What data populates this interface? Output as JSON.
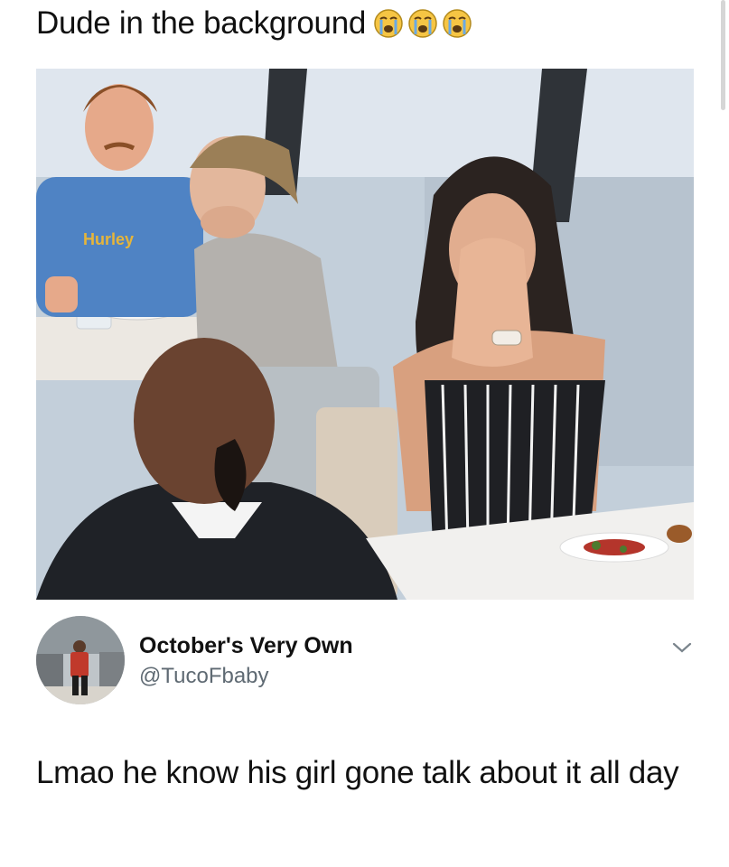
{
  "meme": {
    "caption": "Dude in the background",
    "caption_emoji": [
      "loudly-crying-face-icon",
      "loudly-crying-face-icon",
      "loudly-crying-face-icon"
    ],
    "shirt_logo": "Hurley"
  },
  "tweet": {
    "display_name": "October's Very Own",
    "handle": "@TucoFbaby",
    "text": "Lmao he know his girl gone talk about it all day",
    "menu_icon": "chevron-down-icon"
  },
  "colors": {
    "text": "#111111",
    "handle": "#5f6a73",
    "emoji_face": "#f6c544",
    "emoji_tears": "#6aa9e4"
  }
}
